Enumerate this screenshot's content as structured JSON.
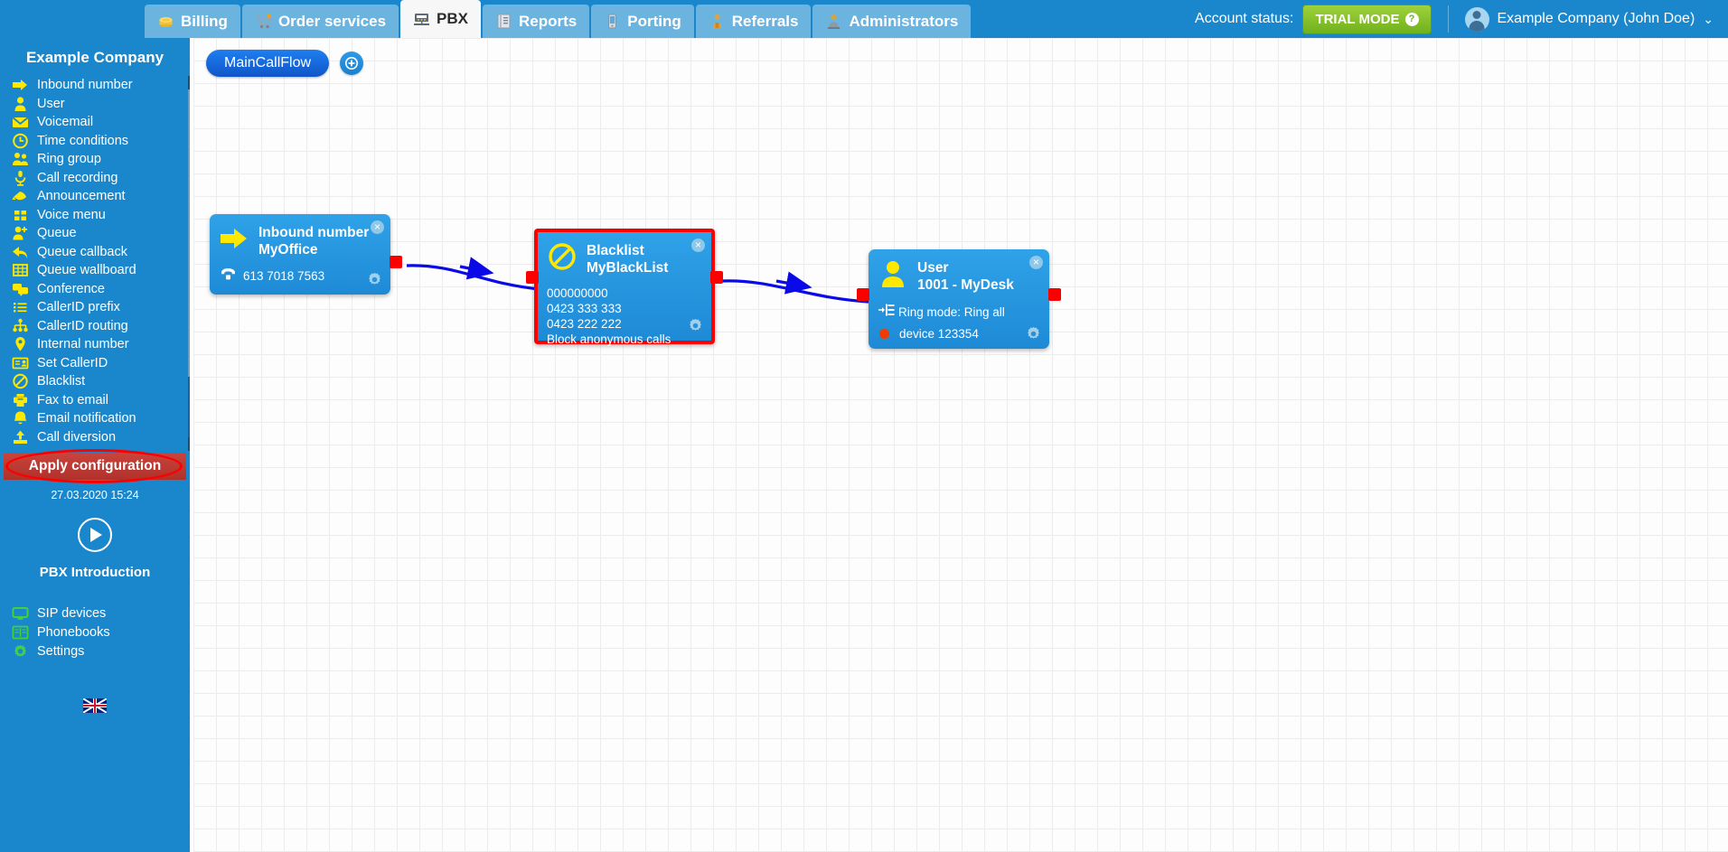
{
  "header": {
    "tabs": [
      {
        "label": "Billing",
        "icon": "coins-icon",
        "active": false
      },
      {
        "label": "Order services",
        "icon": "shopping-cart-icon",
        "active": false
      },
      {
        "label": "PBX",
        "icon": "pbx-switch-icon",
        "active": true
      },
      {
        "label": "Reports",
        "icon": "report-document-icon",
        "active": false
      },
      {
        "label": "Porting",
        "icon": "mobile-phone-icon",
        "active": false
      },
      {
        "label": "Referrals",
        "icon": "person-badge-icon",
        "active": false
      },
      {
        "label": "Administrators",
        "icon": "admin-person-icon",
        "active": false
      }
    ],
    "account_status_label": "Account status:",
    "trial_badge": "TRIAL MODE",
    "trial_help": "?",
    "user_name": "Example Company (John Doe)",
    "chevron": "⌄"
  },
  "sidebar": {
    "company": "Example Company",
    "items": [
      {
        "label": "Inbound number",
        "icon": "arrow-right-icon"
      },
      {
        "label": "User",
        "icon": "person-icon"
      },
      {
        "label": "Voicemail",
        "icon": "envelope-icon"
      },
      {
        "label": "Time conditions",
        "icon": "clock-icon"
      },
      {
        "label": "Ring group",
        "icon": "group-icon"
      },
      {
        "label": "Call recording",
        "icon": "microphone-icon"
      },
      {
        "label": "Announcement",
        "icon": "megaphone-icon"
      },
      {
        "label": "Voice menu",
        "icon": "grid-squares-icon"
      },
      {
        "label": "Queue",
        "icon": "person-plus-icon"
      },
      {
        "label": "Queue callback",
        "icon": "arrow-back-icon"
      },
      {
        "label": "Queue wallboard",
        "icon": "table-icon"
      },
      {
        "label": "Conference",
        "icon": "chat-bubbles-icon"
      },
      {
        "label": "CallerID prefix",
        "icon": "list-icon"
      },
      {
        "label": "CallerID routing",
        "icon": "sitemap-icon"
      },
      {
        "label": "Internal number",
        "icon": "map-pin-icon"
      },
      {
        "label": "Set CallerID",
        "icon": "id-card-icon"
      },
      {
        "label": "Blacklist",
        "icon": "block-circle-icon"
      },
      {
        "label": "Fax to email",
        "icon": "printer-icon"
      },
      {
        "label": "Email notification",
        "icon": "bell-icon"
      },
      {
        "label": "Call diversion",
        "icon": "upload-arrow-icon"
      }
    ],
    "apply_button": "Apply configuration",
    "apply_timestamp": "27.03.2020 15:24",
    "intro_label": "PBX Introduction",
    "bottom_items": [
      {
        "label": "SIP devices",
        "icon": "monitor-icon"
      },
      {
        "label": "Phonebooks",
        "icon": "book-icon"
      },
      {
        "label": "Settings",
        "icon": "gear-icon"
      }
    ],
    "language_flag": "uk-flag-icon",
    "scrollbar": {
      "up": "▲",
      "down": "▼"
    }
  },
  "canvas": {
    "flow_tab": "MainCallFlow",
    "add_flow": "⊕",
    "nodes": [
      {
        "id": "inbound",
        "type": "Inbound number",
        "name": "MyOffice",
        "icon": "arrow-right-icon",
        "phone_icon": "telephone-icon",
        "phone": "613 7018 7563",
        "close": "×",
        "gear": "gear-icon",
        "highlighted": false
      },
      {
        "id": "blacklist",
        "type": "Blacklist",
        "name": "MyBlackList",
        "icon": "block-circle-icon",
        "lines": [
          "000000000",
          "0423 333 333",
          "0423 222 222",
          "Block anonymous calls"
        ],
        "close": "×",
        "gear": "gear-icon",
        "highlighted": true
      },
      {
        "id": "user",
        "type": "User",
        "name": "1001 - MyDesk",
        "icon": "person-icon",
        "ring_icon": "ring-mode-icon",
        "ring_mode": "Ring mode: Ring all",
        "device_icon": "status-dot-icon",
        "device": "device 123354",
        "close": "×",
        "gear": "gear-icon",
        "highlighted": false
      }
    ]
  },
  "colors": {
    "brand_blue": "#1a87cd",
    "node_blue": "#2396e0",
    "highlight_red": "#fc0000",
    "link_blue": "#0a0ae8",
    "accent_yellow": "#ffeb00",
    "accent_green": "#3fd13f",
    "trial_green": "#7cb91e"
  }
}
